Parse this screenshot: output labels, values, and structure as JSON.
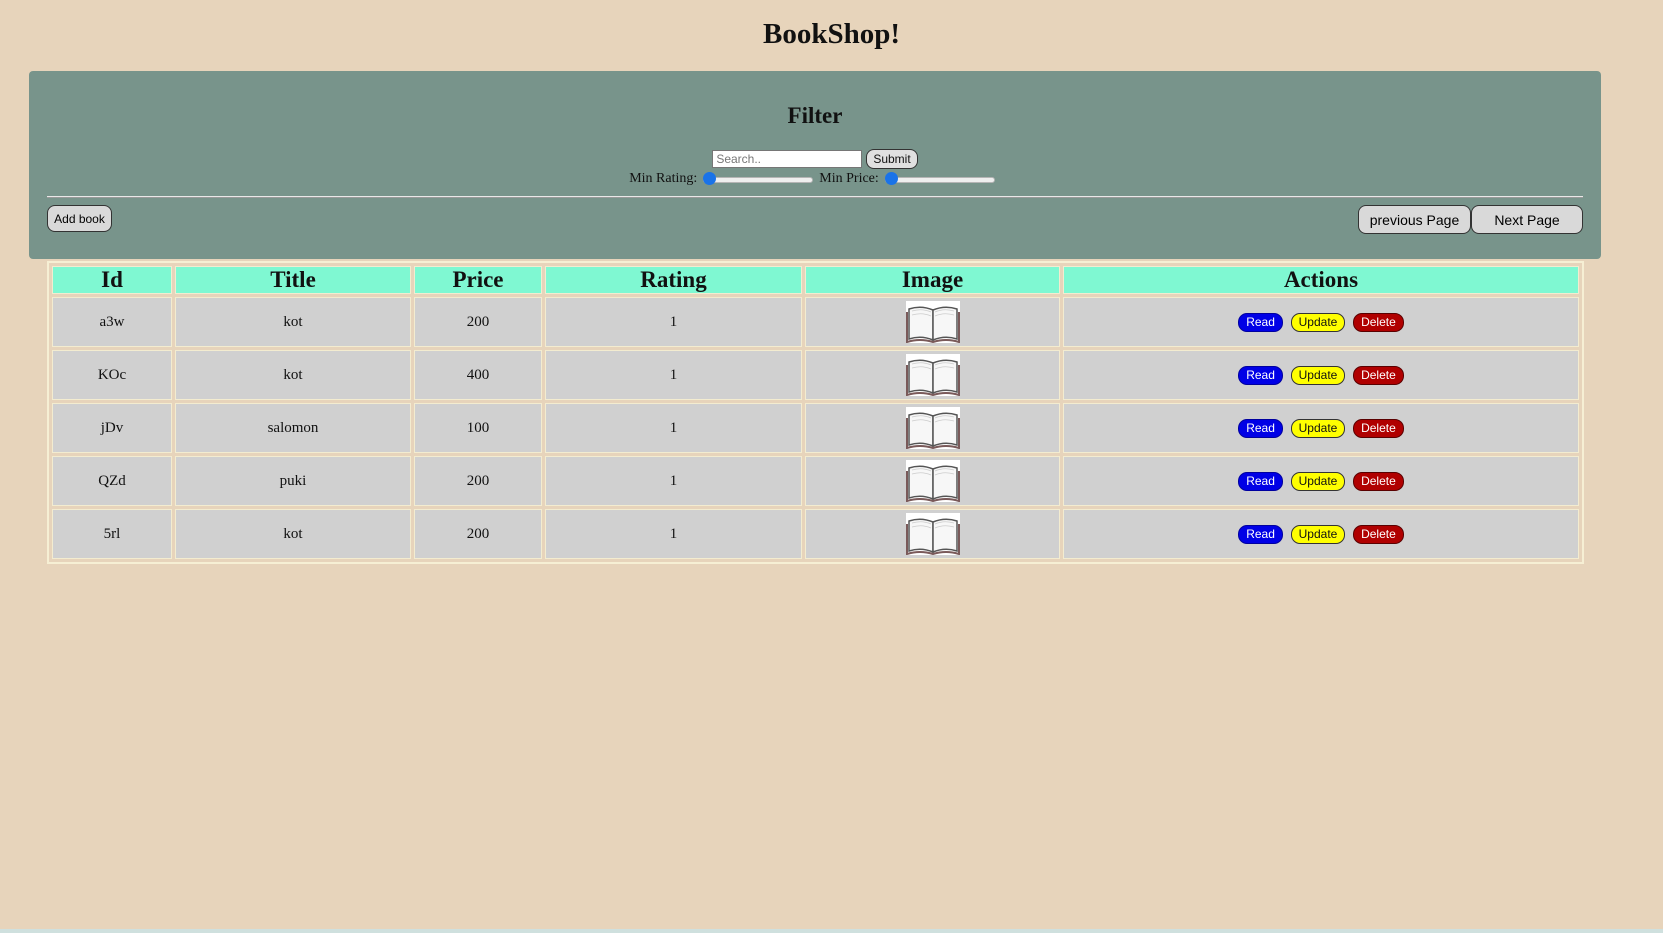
{
  "app": {
    "title": "BookShop!"
  },
  "filter": {
    "heading": "Filter",
    "search_placeholder": "Search..",
    "submit_label": "Submit",
    "min_rating_label": "Min Rating:",
    "min_rating_value": 0,
    "min_price_label": "Min Price:",
    "min_price_value": 0,
    "add_book_label": "Add book",
    "prev_page_label": "previous Page",
    "next_page_label": "Next Page"
  },
  "table": {
    "columns": [
      "Id",
      "Title",
      "Price",
      "Rating",
      "Image",
      "Actions"
    ],
    "rows": [
      {
        "id": "a3w",
        "title": "kot",
        "price": "200",
        "rating": "1"
      },
      {
        "id": "KOc",
        "title": "kot",
        "price": "400",
        "rating": "1"
      },
      {
        "id": "jDv",
        "title": "salomon",
        "price": "100",
        "rating": "1"
      },
      {
        "id": "QZd",
        "title": "puki",
        "price": "200",
        "rating": "1"
      },
      {
        "id": "5rl",
        "title": "kot",
        "price": "200",
        "rating": "1"
      }
    ],
    "actions": {
      "read": "Read",
      "update": "Update",
      "delete": "Delete"
    },
    "image_icon": "open-book-icon"
  },
  "colors": {
    "background": "#e7d4bb",
    "panel": "#78948b",
    "header_cell": "#7ff8d2",
    "body_cell": "#d0d0d0",
    "read": "#0000e6",
    "update": "#ffff00",
    "delete": "#b00000"
  }
}
